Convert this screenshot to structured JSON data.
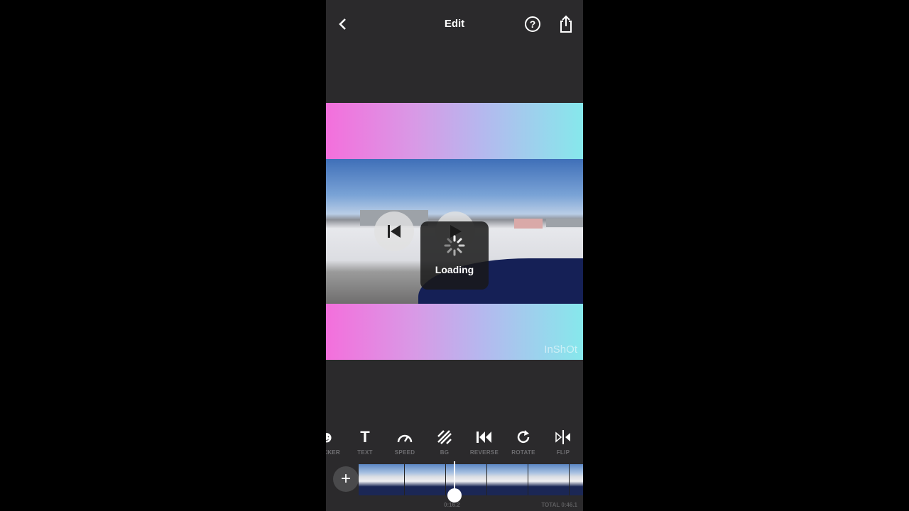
{
  "header": {
    "title": "Edit",
    "back_icon": "chevron-left-icon",
    "help_icon": "question-circle-icon",
    "share_icon": "share-icon"
  },
  "preview": {
    "loading_label": "Loading",
    "watermark": "InShOt",
    "gradient_colors": [
      "#f46fdc",
      "#86e8ec"
    ]
  },
  "tools": [
    {
      "label": "STICKER",
      "icon": "sticker-icon",
      "visible_label": "KER"
    },
    {
      "label": "TEXT",
      "icon": "text-icon"
    },
    {
      "label": "SPEED",
      "icon": "speedometer-icon"
    },
    {
      "label": "BG",
      "icon": "background-hatch-icon"
    },
    {
      "label": "REVERSE",
      "icon": "reverse-icon"
    },
    {
      "label": "ROTATE",
      "icon": "rotate-icon"
    },
    {
      "label": "FLIP",
      "icon": "flip-icon"
    }
  ],
  "timeline": {
    "add_label": "+",
    "current_time": "0:16.2",
    "total": "TOTAL 0:46.1"
  }
}
